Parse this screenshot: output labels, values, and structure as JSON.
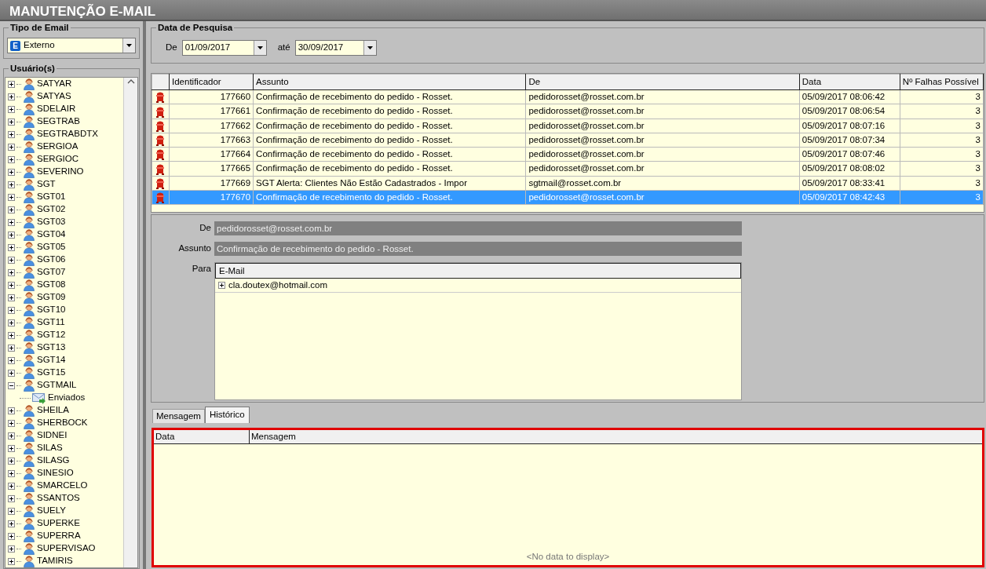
{
  "title": "MANUTENÇÃO E-MAIL",
  "email_type": {
    "label": "Tipo de Email",
    "badge": "E",
    "value": "Externo"
  },
  "users": {
    "label": "Usuário(s)",
    "items": [
      {
        "name": "SATYAR",
        "expanded": false
      },
      {
        "name": "SATYAS",
        "expanded": false
      },
      {
        "name": "SDELAIR",
        "expanded": false
      },
      {
        "name": "SEGTRAB",
        "expanded": false
      },
      {
        "name": "SEGTRABDTX",
        "expanded": false
      },
      {
        "name": "SERGIOA",
        "expanded": false
      },
      {
        "name": "SERGIOC",
        "expanded": false
      },
      {
        "name": "SEVERINO",
        "expanded": false
      },
      {
        "name": "SGT",
        "expanded": false
      },
      {
        "name": "SGT01",
        "expanded": false
      },
      {
        "name": "SGT02",
        "expanded": false
      },
      {
        "name": "SGT03",
        "expanded": false
      },
      {
        "name": "SGT04",
        "expanded": false
      },
      {
        "name": "SGT05",
        "expanded": false
      },
      {
        "name": "SGT06",
        "expanded": false
      },
      {
        "name": "SGT07",
        "expanded": false
      },
      {
        "name": "SGT08",
        "expanded": false
      },
      {
        "name": "SGT09",
        "expanded": false
      },
      {
        "name": "SGT10",
        "expanded": false
      },
      {
        "name": "SGT11",
        "expanded": false
      },
      {
        "name": "SGT12",
        "expanded": false
      },
      {
        "name": "SGT13",
        "expanded": false
      },
      {
        "name": "SGT14",
        "expanded": false
      },
      {
        "name": "SGT15",
        "expanded": false
      },
      {
        "name": "SGTMAIL",
        "expanded": true,
        "children": [
          {
            "name": "Enviados"
          }
        ]
      },
      {
        "name": "SHEILA",
        "expanded": false
      },
      {
        "name": "SHERBOCK",
        "expanded": false
      },
      {
        "name": "SIDNEI",
        "expanded": false
      },
      {
        "name": "SILAS",
        "expanded": false
      },
      {
        "name": "SILASG",
        "expanded": false
      },
      {
        "name": "SINESIO",
        "expanded": false
      },
      {
        "name": "SMARCELO",
        "expanded": false
      },
      {
        "name": "SSANTOS",
        "expanded": false
      },
      {
        "name": "SUELY",
        "expanded": false
      },
      {
        "name": "SUPERKE",
        "expanded": false
      },
      {
        "name": "SUPERRA",
        "expanded": false
      },
      {
        "name": "SUPERVISAO",
        "expanded": false
      },
      {
        "name": "TAMIRIS",
        "expanded": false
      }
    ]
  },
  "search": {
    "label": "Data de Pesquisa",
    "from_label": "De",
    "from": "01/09/2017",
    "to_label": "até",
    "to": "30/09/2017"
  },
  "emails": {
    "columns": [
      "Identificador",
      "Assunto",
      "De",
      "Data",
      "Nº Falhas Possível"
    ],
    "rows": [
      {
        "id": "177660",
        "subject": "Confirmação de recebimento do pedido - Rosset.",
        "from": "pedidorosset@rosset.com.br",
        "date": "05/09/2017 08:06:42",
        "failures": "3",
        "selected": false
      },
      {
        "id": "177661",
        "subject": "Confirmação de recebimento do pedido - Rosset.",
        "from": "pedidorosset@rosset.com.br",
        "date": "05/09/2017 08:06:54",
        "failures": "3",
        "selected": false
      },
      {
        "id": "177662",
        "subject": "Confirmação de recebimento do pedido - Rosset.",
        "from": "pedidorosset@rosset.com.br",
        "date": "05/09/2017 08:07:16",
        "failures": "3",
        "selected": false
      },
      {
        "id": "177663",
        "subject": "Confirmação de recebimento do pedido - Rosset.",
        "from": "pedidorosset@rosset.com.br",
        "date": "05/09/2017 08:07:34",
        "failures": "3",
        "selected": false
      },
      {
        "id": "177664",
        "subject": "Confirmação de recebimento do pedido - Rosset.",
        "from": "pedidorosset@rosset.com.br",
        "date": "05/09/2017 08:07:46",
        "failures": "3",
        "selected": false
      },
      {
        "id": "177665",
        "subject": "Confirmação de recebimento do pedido - Rosset.",
        "from": "pedidorosset@rosset.com.br",
        "date": "05/09/2017 08:08:02",
        "failures": "3",
        "selected": false
      },
      {
        "id": "177669",
        "subject": "SGT Alerta: Clientes Não Estão Cadastrados - Impor",
        "from": "sgtmail@rosset.com.br",
        "date": "05/09/2017 08:33:41",
        "failures": "3",
        "selected": false
      },
      {
        "id": "177670",
        "subject": "Confirmação de recebimento do pedido - Rosset.",
        "from": "pedidorosset@rosset.com.br",
        "date": "05/09/2017 08:42:43",
        "failures": "3",
        "selected": true
      }
    ]
  },
  "detail": {
    "from_label": "De",
    "from": "pedidorosset@rosset.com.br",
    "subject_label": "Assunto",
    "subject": "Confirmação de recebimento do pedido - Rosset.",
    "to_label": "Para",
    "recipients_column": "E-Mail",
    "recipients": [
      {
        "address": "cla.doutex@hotmail.com",
        "expanded": false
      }
    ]
  },
  "tabs": [
    {
      "label": "Mensagem",
      "selected": false
    },
    {
      "label": "Histórico",
      "selected": true
    }
  ],
  "history": {
    "columns": [
      "Data",
      "Mensagem"
    ],
    "empty_text": "<No data to display>"
  }
}
